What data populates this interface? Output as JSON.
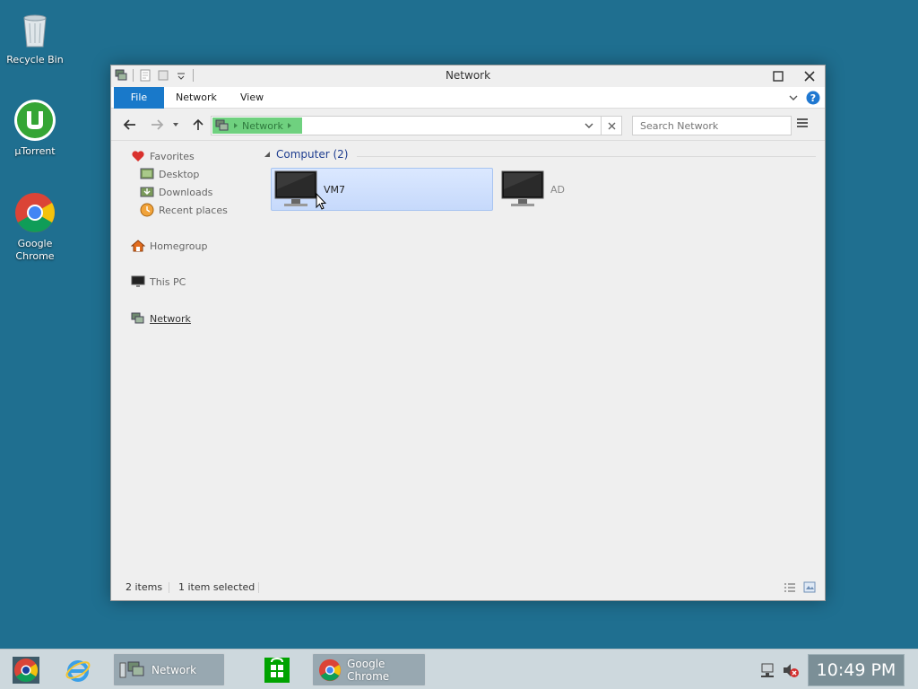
{
  "desktop": {
    "icons": [
      {
        "label": "Recycle Bin"
      },
      {
        "label": "µTorrent"
      },
      {
        "label": "Google Chrome"
      }
    ]
  },
  "window": {
    "title": "Network",
    "ribbon": {
      "file": "File",
      "tabs": [
        "Network",
        "View"
      ]
    },
    "address": {
      "crumb": "Network"
    },
    "search": {
      "placeholder": "Search Network"
    },
    "nav": {
      "favorites": "Favorites",
      "desktop": "Desktop",
      "downloads": "Downloads",
      "recent": "Recent places",
      "homegroup": "Homegroup",
      "thispc": "This PC",
      "network": "Network"
    },
    "group": {
      "title": "Computer (2)",
      "items": [
        {
          "name": "VM7",
          "selected": true
        },
        {
          "name": "AD",
          "selected": false
        }
      ]
    },
    "status": {
      "count": "2 items",
      "selected": "1 item selected"
    }
  },
  "taskbar": {
    "explorer_label": "Network",
    "chrome_label": "Google Chrome",
    "clock": "10:49 PM"
  },
  "colors": {
    "desktop": "#1f6f90",
    "ribbon_file": "#1979ca",
    "crumb": "#6fd17f",
    "selection": "#c6d9fb"
  }
}
